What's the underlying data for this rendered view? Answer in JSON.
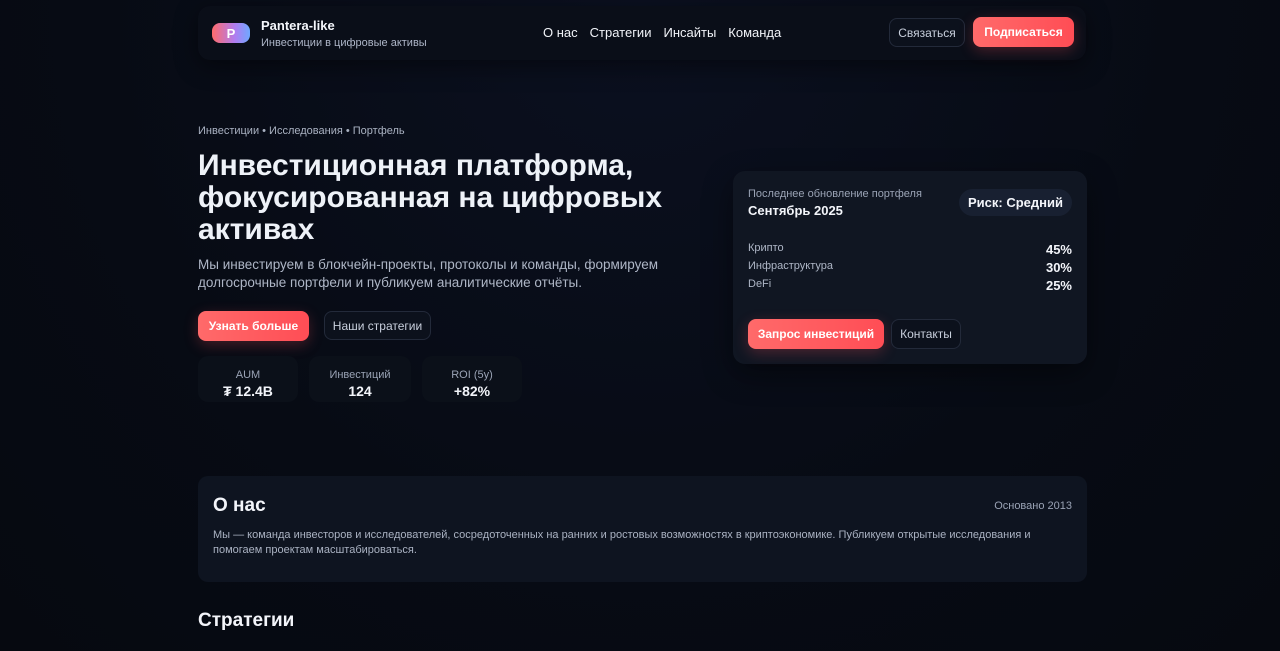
{
  "header": {
    "logo_letter": "P",
    "brand_name": "Pantera-like",
    "brand_sub": "Инвестиции в цифровые активы",
    "nav": [
      "О нас",
      "Стратегии",
      "Инсайты",
      "Команда"
    ],
    "contact_label": "Связаться",
    "subscribe_label": "Подписаться"
  },
  "hero": {
    "breadcrumb": "Инвестиции • Исследования • Портфель",
    "title_line1": "Инвестиционная платформа,",
    "title_line2": "фокусированная на цифровых",
    "title_line3": "активах",
    "description": "Мы инвестируем в блокчейн-проекты, протоколы и команды, формируем долгосрочные портфели и публикуем аналитические отчёты.",
    "learn_more_label": "Узнать больше",
    "strategies_label": "Наши стратегии",
    "stats": [
      {
        "label": "AUM",
        "value": "₮ 12.4B"
      },
      {
        "label": "Инвестиций",
        "value": "124"
      },
      {
        "label": "ROI (5y)",
        "value": "+82%"
      }
    ]
  },
  "portfolio_card": {
    "update_label": "Последнее обновление портфеля",
    "update_date": "Сентябрь 2025",
    "risk": "Риск: Средний",
    "allocations": [
      {
        "name": "Крипто",
        "value": "45%"
      },
      {
        "name": "Инфраструктура",
        "value": "30%"
      },
      {
        "name": "DeFi",
        "value": "25%"
      }
    ],
    "request_label": "Запрос инвестиций",
    "contacts_label": "Контакты"
  },
  "about": {
    "title": "О нас",
    "founded": "Основано 2013",
    "text": "Мы — команда инвесторов и исследователей, сосредоточенных на ранних и ростовых возможностях в криптоэкономике. Публикуем открытые исследования и помогаем проектам масштабироваться."
  },
  "strategies_section": {
    "title": "Стратегии"
  },
  "colors": {
    "accent": "#ff5a5f",
    "background": "#070b14",
    "card": "#101622"
  }
}
